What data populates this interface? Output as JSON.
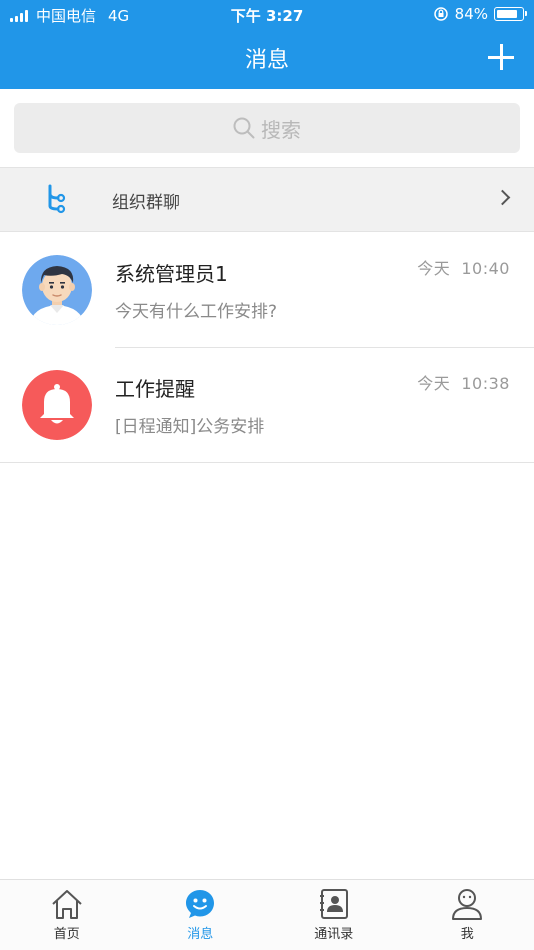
{
  "statusbar": {
    "carrier": "中国电信",
    "network": "4G",
    "time": "下午 3:27",
    "battery": "84%",
    "battery_level": 0.84
  },
  "header": {
    "title": "消息",
    "add_icon": "plus-icon"
  },
  "search": {
    "placeholder": "搜索",
    "icon": "search-icon"
  },
  "org_group": {
    "label": "组织群聊",
    "icon": "org-tree-icon"
  },
  "messages": [
    {
      "name": "系统管理员1",
      "time": "今天  10:40",
      "preview": "今天有什么工作安排?",
      "avatar": "person-avatar"
    },
    {
      "name": "工作提醒",
      "time": "今天  10:38",
      "preview": "[日程通知]公务安排",
      "avatar": "bell-icon",
      "avatar_color": "#f65a5a"
    }
  ],
  "tabbar": {
    "items": [
      {
        "label": "首页",
        "icon": "home-icon",
        "active": false
      },
      {
        "label": "消息",
        "icon": "chat-bubble-icon",
        "active": true
      },
      {
        "label": "通讯录",
        "icon": "contacts-book-icon",
        "active": false
      },
      {
        "label": "我",
        "icon": "profile-icon",
        "active": false
      }
    ]
  },
  "colors": {
    "accent": "#2196e8",
    "alert": "#f65a5a"
  }
}
